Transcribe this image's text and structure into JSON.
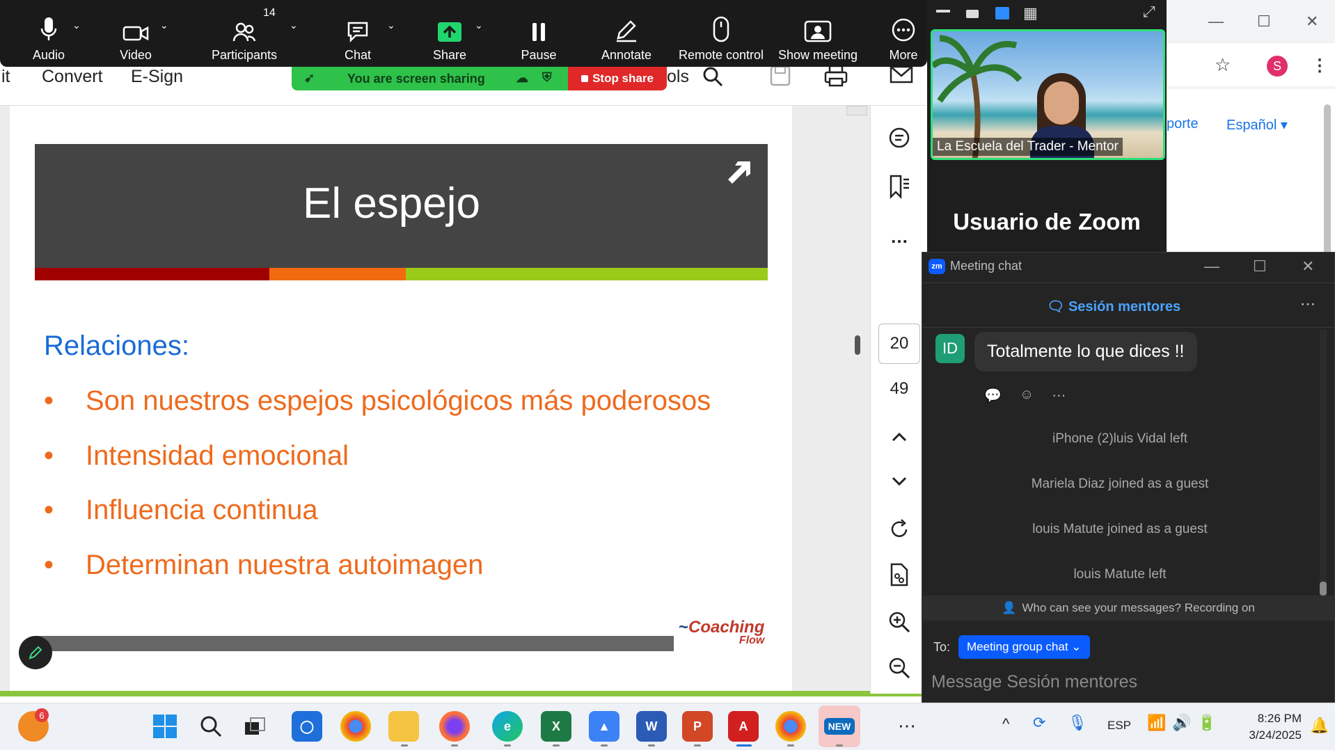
{
  "zoom_toolbar": {
    "audio": "Audio",
    "video": "Video",
    "participants": "Participants",
    "participants_count": "14",
    "chat": "Chat",
    "share": "Share",
    "pause": "Pause",
    "annotate": "Annotate",
    "remote_control": "Remote control",
    "show_meeting": "Show meeting",
    "more": "More"
  },
  "share_banner": {
    "status": "You are screen sharing",
    "stop": "Stop share"
  },
  "acrobat": {
    "menu": [
      "it",
      "Convert",
      "E-Sign",
      "ols"
    ],
    "page_current": "20",
    "page_total": "49"
  },
  "slide": {
    "title": "El espejo",
    "subtitle": "Relaciones:",
    "bullets": [
      "Son nuestros espejos psicológicos más poderosos",
      "Intensidad emocional",
      "Influencia continua",
      "Determinan nuestra autoimagen"
    ],
    "logo": "Coaching",
    "logo_sub": "Flow",
    "stripe_colors": [
      "#a00000",
      "#f26a10",
      "#9bcb1a"
    ]
  },
  "video": {
    "tile_name": "La Escuela del Trader - Mentor",
    "other_user": "Usuario de Zoom"
  },
  "chrome": {
    "link1": "porte",
    "link2": "Español",
    "avatar": "S"
  },
  "chat": {
    "window_title": "Meeting chat",
    "session": "Sesión mentores",
    "sender_initials": "ID",
    "message": "Totalmente  lo que dices !!",
    "system_messages": [
      "iPhone (2)luis Vidal  left",
      "Mariela Diaz joined as a guest",
      "louis Matute joined as a guest",
      "louis Matute left"
    ],
    "privacy_notice": "Who can see your messages? Recording on",
    "to_label": "To:",
    "to_value": "Meeting group chat",
    "input_placeholder": "Message Sesión mentores"
  },
  "taskbar": {
    "notification_count": "6",
    "language": "ESP",
    "time": "8:26 PM",
    "date": "3/24/2025",
    "outlook_badge": "NEW"
  }
}
